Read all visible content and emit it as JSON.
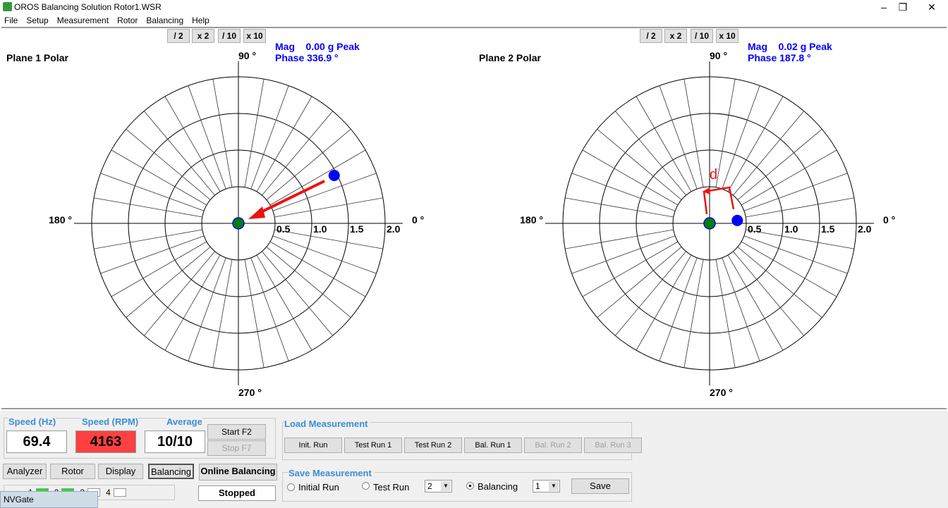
{
  "window": {
    "title": "OROS Balancing Solution Rotor1.WSR",
    "minimize": "–",
    "restore": "❐",
    "close": "✕"
  },
  "menu": [
    "File",
    "Setup",
    "Measurement",
    "Rotor",
    "Balancing",
    "Help"
  ],
  "scale_buttons": [
    "/ 2",
    "x 2",
    "/ 10",
    "x 10"
  ],
  "planes": [
    {
      "title": "Plane 1  Polar",
      "mag": "Mag    0.00 g Peak",
      "phase": "Phase 336.9 °",
      "point": {
        "mag": 1.46,
        "angle_deg": 26.6
      },
      "origin_color": "#008000",
      "point_color": "#0000ff",
      "annotation": "arrow"
    },
    {
      "title": "Plane 2  Polar",
      "mag": "Mag    0.02 g Peak",
      "phase": "Phase 187.8 °",
      "point": {
        "mag": 0.38,
        "angle_deg": 6
      },
      "origin_color": "#008000",
      "point_color": "#0000ff",
      "annotation": "bracket",
      "annotation_label": "d"
    }
  ],
  "polar": {
    "angle_labels": {
      "a0": "0 °",
      "a90": "90 °",
      "a180": "180 °",
      "a270": "270 °"
    },
    "ring_labels": [
      "0.5",
      "1.0",
      "1.5",
      "2.0"
    ],
    "rings": [
      0.5,
      1.0,
      1.5,
      2.0
    ],
    "spoke_step_deg": 10
  },
  "speed": {
    "hz_label": "Speed (Hz)",
    "hz": "69.4",
    "rpm_label": "Speed (RPM)",
    "rpm": "4163",
    "rpm_color": "#ff4040",
    "avg_label": "Average",
    "avg": "10/10"
  },
  "controls": {
    "start": "Start  F2",
    "stop": "Stop  F7",
    "analyzer": "Analyzer",
    "rotor": "Rotor",
    "display": "Display",
    "balancing": "Balancing",
    "online": "Online Balancing",
    "status": "Stopped"
  },
  "channels": [
    {
      "n": "1",
      "active": true
    },
    {
      "n": "2",
      "active": true
    },
    {
      "n": "3",
      "active": false
    },
    {
      "n": "4",
      "active": false
    }
  ],
  "taskbar_tooltip": "NVGate",
  "load": {
    "label": "Load Measurement",
    "buttons": [
      {
        "t": "Init. Run",
        "en": true
      },
      {
        "t": "Test Run 1",
        "en": true
      },
      {
        "t": "Test Run 2",
        "en": true
      },
      {
        "t": "Bal. Run 1",
        "en": true
      },
      {
        "t": "Bal. Run 2",
        "en": false
      },
      {
        "t": "Bal. Run 3",
        "en": false
      }
    ]
  },
  "save": {
    "label": "Save Measurement",
    "initial": "Initial Run",
    "test": "Test Run",
    "test_sel": "2",
    "balancing": "Balancing",
    "bal_sel": "1",
    "selected": "balancing",
    "save": "Save"
  }
}
